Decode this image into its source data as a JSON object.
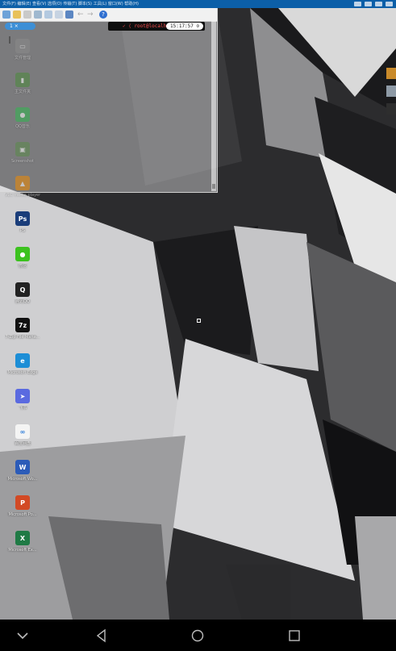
{
  "topbar": {
    "menu_text": "文件(F) 编辑(E) 查看(V) 选项(O) 传输(T) 脚本(S) 工具(L) 窗口(W) 帮助(H)"
  },
  "terminal": {
    "tab_label": "1 ×",
    "prompt_user": "✓ ⟨ root@localhost",
    "clock": "15:17:57 ⊙"
  },
  "desktop_icons": [
    {
      "name": "computer-icon",
      "label": "文件管理",
      "color": "#8a8a8a",
      "glyph": "▭"
    },
    {
      "name": "folder-icon",
      "label": "主文件夹",
      "color": "#4a8a3a",
      "glyph": "▮"
    },
    {
      "name": "qq-music-icon",
      "label": "QQ音乐",
      "color": "#2fb84f",
      "glyph": "●"
    },
    {
      "name": "screenshot-icon",
      "label": "Screenshot",
      "color": "#5a8a4a",
      "glyph": "▣"
    },
    {
      "name": "vlc-icon",
      "label": "VLC media player",
      "color": "#f08a00",
      "glyph": "▲"
    },
    {
      "name": "photoshop-icon",
      "label": "PS",
      "color": "#1a3d7a",
      "glyph": "Ps"
    },
    {
      "name": "wechat-icon",
      "label": "微信",
      "color": "#3cc21f",
      "glyph": "●"
    },
    {
      "name": "qq-icon",
      "label": "腾讯QQ",
      "color": "#222222",
      "glyph": "Q"
    },
    {
      "name": "7zip-icon",
      "label": "7-Zip File Mana...",
      "color": "#111111",
      "glyph": "7z"
    },
    {
      "name": "edge-icon",
      "label": "Microsoft Edge",
      "color": "#1d8ed6",
      "glyph": "e"
    },
    {
      "name": "feishu-icon",
      "label": "飞书",
      "color": "#5a6ae0",
      "glyph": "➤"
    },
    {
      "name": "baidu-netdisk-icon",
      "label": "百度网盘",
      "color": "#f4f4f4",
      "glyph": "∞"
    },
    {
      "name": "word-icon",
      "label": "Microsoft Wo...",
      "color": "#2b5bb8",
      "glyph": "W"
    },
    {
      "name": "powerpoint-icon",
      "label": "Microsoft Po...",
      "color": "#d24a25",
      "glyph": "P"
    },
    {
      "name": "excel-icon",
      "label": "Microsoft Ex...",
      "color": "#1f7a45",
      "glyph": "X"
    }
  ],
  "colors": {
    "topbar": "#0c5fa8",
    "terminal_tab": "#3d8fd6",
    "prompt_text": "#ff4f4f"
  }
}
